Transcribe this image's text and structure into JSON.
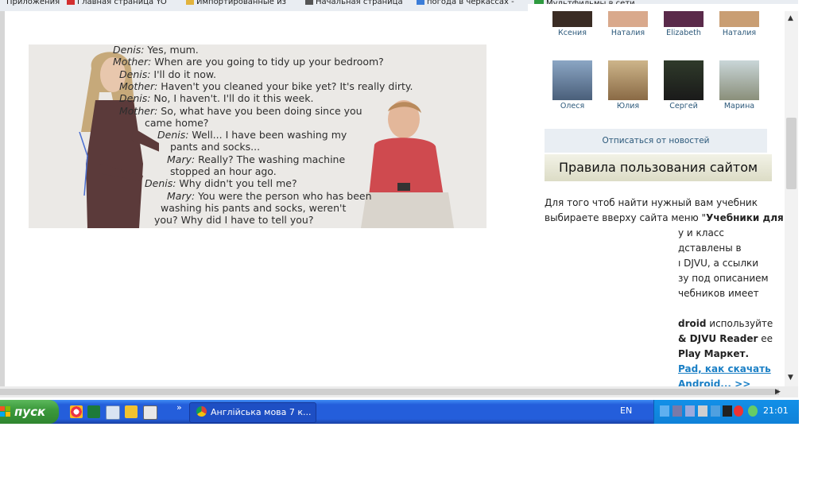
{
  "bookmarks": [
    {
      "label": "Приложения",
      "icon": "apps-icon",
      "color": "#5b6f8a"
    },
    {
      "label": "Главная страница YO",
      "icon": "youtube-icon",
      "color": "#d32f2f"
    },
    {
      "label": "Импортированные из",
      "icon": "folder-icon",
      "color": "#e2b33c"
    },
    {
      "label": "Начальная страница",
      "icon": "page-icon",
      "color": "#555555"
    },
    {
      "label": "погода в черкассах -",
      "icon": "weather-icon",
      "color": "#3b7dd8"
    },
    {
      "label": "Мультфильмы в сети...",
      "icon": "vk-icon",
      "color": "#2e9a3f"
    }
  ],
  "dialogue": [
    {
      "speaker": "Denis:",
      "text": " Yes, mum."
    },
    {
      "speaker": "Mother:",
      "text": " When are you going to tidy up your bedroom?"
    },
    {
      "speaker": "Denis:",
      "text": " I'll do it now."
    },
    {
      "speaker": "Mother:",
      "text": " Haven't you cleaned your bike yet? It's really dirty."
    },
    {
      "speaker": "Denis:",
      "text": " No, I haven't. I'll do it this week."
    },
    {
      "speaker": "Mother:",
      "text": " So, what have you been doing since you"
    },
    {
      "speaker": "",
      "text": "came home?"
    },
    {
      "speaker": "Denis:",
      "text": " Well... I have been washing my"
    },
    {
      "speaker": "",
      "text": "pants and socks..."
    },
    {
      "speaker": "Mary:",
      "text": " Really? The washing machine"
    },
    {
      "speaker": "",
      "text": "stopped an hour ago."
    },
    {
      "speaker": "Denis:",
      "text": " Why didn't you tell me?"
    },
    {
      "speaker": "Mary:",
      "text": " You were the person who has been"
    },
    {
      "speaker": "",
      "text": "washing his pants and socks, weren't"
    },
    {
      "speaker": "",
      "text": "you? Why did I have to tell you?"
    }
  ],
  "sidebar": {
    "friends_row1": [
      "Ксения",
      "Наталия",
      "Elizabeth",
      "Наталия"
    ],
    "friends_row2": [
      "Олеся",
      "Юлия",
      "Сергей",
      "Марина"
    ],
    "unsubscribe": "Отписаться от новостей",
    "rules_title": "Правила пользования сайтом",
    "desc_line1": "Для того чтоб найти нужный вам учебник",
    "desc_line2a": "выбираете вверху сайта меню \"",
    "desc_line2b": "Учебники для",
    "desc_partial": [
      "у и класс",
      "дставлены в",
      "ı DJVU, а ссылки",
      "зу под описанием",
      "чебников имеет"
    ],
    "android_a": "droid",
    "android_b": " используйте",
    "reader_a": "& DJVU Reader",
    "reader_b": " ее",
    "market": "Play Маркет.",
    "link1": "Pad, как скачать",
    "link2": "Android... >>"
  },
  "taskbar": {
    "start_label": "пуск",
    "task_label": "Англійська мова 7 к...",
    "language": "EN",
    "clock": "21:01",
    "expand_arrows": "»"
  }
}
